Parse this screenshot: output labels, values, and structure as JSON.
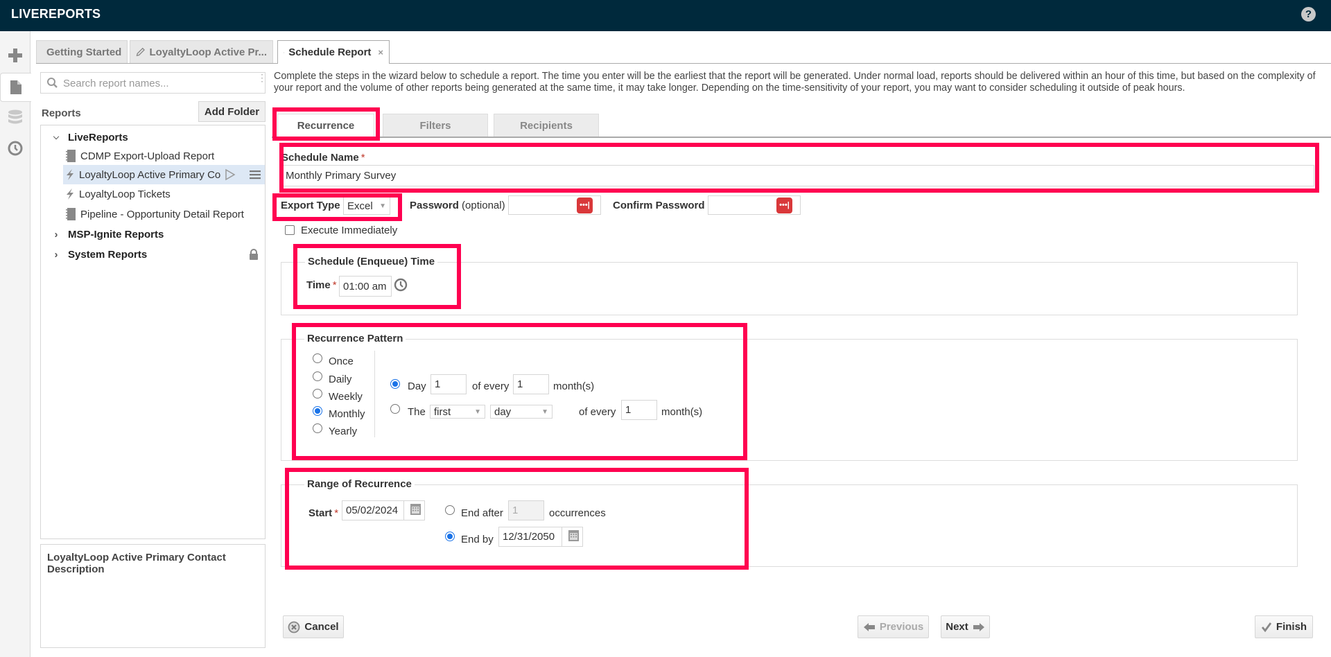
{
  "app": {
    "title": "LIVEREPORTS",
    "help_icon": "question-circle-icon"
  },
  "iconbar": {
    "items": [
      {
        "name": "add",
        "icon": "plus-icon"
      },
      {
        "name": "reports",
        "icon": "document-icon",
        "selected": true
      },
      {
        "name": "data",
        "icon": "database-icon"
      },
      {
        "name": "schedules",
        "icon": "clock-icon"
      }
    ]
  },
  "doc_tabs": [
    {
      "label": "Getting Started",
      "icon": "arrow-circle-icon"
    },
    {
      "label": "LoyaltyLoop Active Pr...",
      "icon": "pencil-icon"
    },
    {
      "label": "Schedule Report",
      "icon": "clock-icon",
      "active": true,
      "close": "×"
    }
  ],
  "sidebar": {
    "search_placeholder": "Search report names...",
    "reports_label": "Reports",
    "add_folder_label": "Add Folder",
    "tree": [
      {
        "label": "LiveReports",
        "type": "folder",
        "expanded": true,
        "caret": "⌄"
      },
      {
        "label": "CDMP Export-Upload Report",
        "type": "report",
        "icon": "notebook-icon"
      },
      {
        "label": "LoyaltyLoop Active Primary Con",
        "type": "report",
        "icon": "lightning-icon",
        "selected": true
      },
      {
        "label": "LoyaltyLoop Tickets",
        "type": "report",
        "icon": "lightning-icon"
      },
      {
        "label": "Pipeline - Opportunity Detail Report",
        "type": "report",
        "icon": "notebook-icon"
      },
      {
        "label": "MSP-Ignite Reports",
        "type": "folder",
        "expanded": false,
        "caret": "›"
      },
      {
        "label": "System Reports",
        "type": "folder",
        "expanded": false,
        "caret": "›",
        "locked": true
      }
    ],
    "description_title": "LoyaltyLoop Active Primary Contact Description"
  },
  "main": {
    "intro": "Complete the steps in the wizard below to schedule a report. The time you enter will be the earliest that the report will be generated. Under normal load, reports should be delivered within an hour of this time, but based on the complexity of your report and the volume of other reports being generated at the same time, it may take longer. Depending on the time-sensitivity of your report, you may want to consider scheduling it outside of peak hours.",
    "wizard_tabs": [
      {
        "label": "Recurrence",
        "active": true
      },
      {
        "label": "Filters"
      },
      {
        "label": "Recipients"
      }
    ],
    "schedule_name": {
      "label": "Schedule Name",
      "required": "*",
      "value": "Monthly Primary Survey"
    },
    "export_type": {
      "label": "Export Type",
      "value": "Excel"
    },
    "password": {
      "label": "Password",
      "hint": "(optional)",
      "value": ""
    },
    "confirm_password": {
      "label": "Confirm Password",
      "value": ""
    },
    "execute_immediately": {
      "label": "Execute Immediately",
      "checked": false
    },
    "schedule_time": {
      "legend": "Schedule (Enqueue) Time",
      "time_label": "Time",
      "required": "*",
      "value": "01:00 am"
    },
    "recurrence_pattern": {
      "legend": "Recurrence Pattern",
      "options": [
        {
          "label": "Once",
          "checked": false
        },
        {
          "label": "Daily",
          "checked": false
        },
        {
          "label": "Weekly",
          "checked": false
        },
        {
          "label": "Monthly",
          "checked": true
        },
        {
          "label": "Yearly",
          "checked": false
        }
      ],
      "monthly": {
        "day_option": {
          "label": "Day",
          "checked": true,
          "day_value": "1",
          "of_every": "of every",
          "months_value": "1",
          "unit": "month(s)"
        },
        "the_option": {
          "label": "The",
          "checked": false,
          "ordinal": "first",
          "weekday": "day",
          "of_every": "of every",
          "months_value": "1",
          "unit": "month(s)"
        }
      }
    },
    "range": {
      "legend": "Range of Recurrence",
      "start_label": "Start",
      "required": "*",
      "start_value": "05/02/2024",
      "end_after": {
        "label": "End after",
        "value": "1",
        "unit": "occurrences",
        "checked": false
      },
      "end_by": {
        "label": "End by",
        "value": "12/31/2050",
        "checked": true
      }
    },
    "buttons": {
      "cancel": "Cancel",
      "previous": "Previous",
      "next": "Next",
      "finish": "Finish"
    },
    "highlight_color": "#ff0050"
  }
}
